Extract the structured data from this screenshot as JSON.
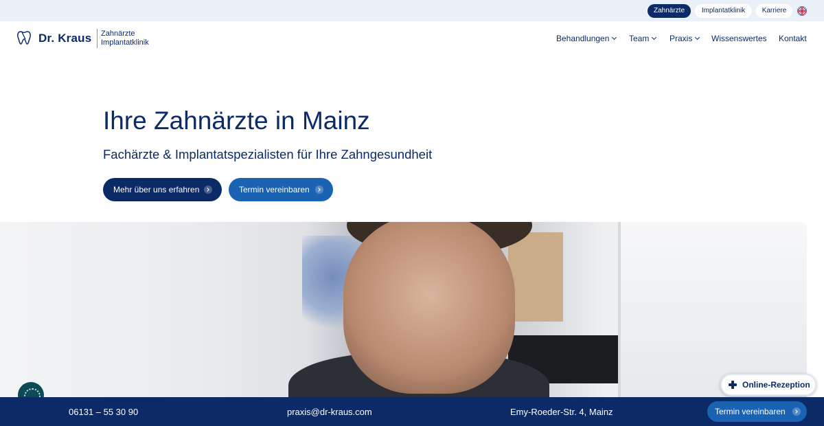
{
  "topbar": {
    "items": [
      {
        "label": "Zahnärzte",
        "active": true
      },
      {
        "label": "Implantatklinik",
        "active": false
      },
      {
        "label": "Karriere",
        "active": false
      }
    ],
    "language_icon": "uk-flag-icon"
  },
  "header": {
    "logo_icon": "tooth-icon",
    "brand": "Dr. Kraus",
    "sub_line1": "Zahnärzte",
    "sub_line2": "Implantatklinik",
    "nav": [
      {
        "label": "Behandlungen",
        "dropdown": true
      },
      {
        "label": "Team",
        "dropdown": true
      },
      {
        "label": "Praxis",
        "dropdown": true
      },
      {
        "label": "Wissenswertes",
        "dropdown": false
      },
      {
        "label": "Kontakt",
        "dropdown": false
      }
    ]
  },
  "hero": {
    "title": "Ihre Zahnärzte in Mainz",
    "subtitle": "Fachärzte & Implantatspezialisten für Ihre Zahngesundheit",
    "primary_button": "Mehr über uns erfahren",
    "secondary_button": "Termin vereinbaren"
  },
  "floating": {
    "fingerprint_icon": "fingerprint-icon",
    "online_reception": "Online-Rezeption",
    "online_reception_icon": "medical-cross-icon"
  },
  "footer": {
    "phone": "06131 – 55 30 90",
    "email": "praxis@dr-kraus.com",
    "address": "Emy-Roeder-Str. 4, Mainz",
    "button": "Termin vereinbaren"
  },
  "colors": {
    "primary": "#0c2a66",
    "accent": "#1a63b3",
    "topbar_bg": "#e9f0f8"
  }
}
